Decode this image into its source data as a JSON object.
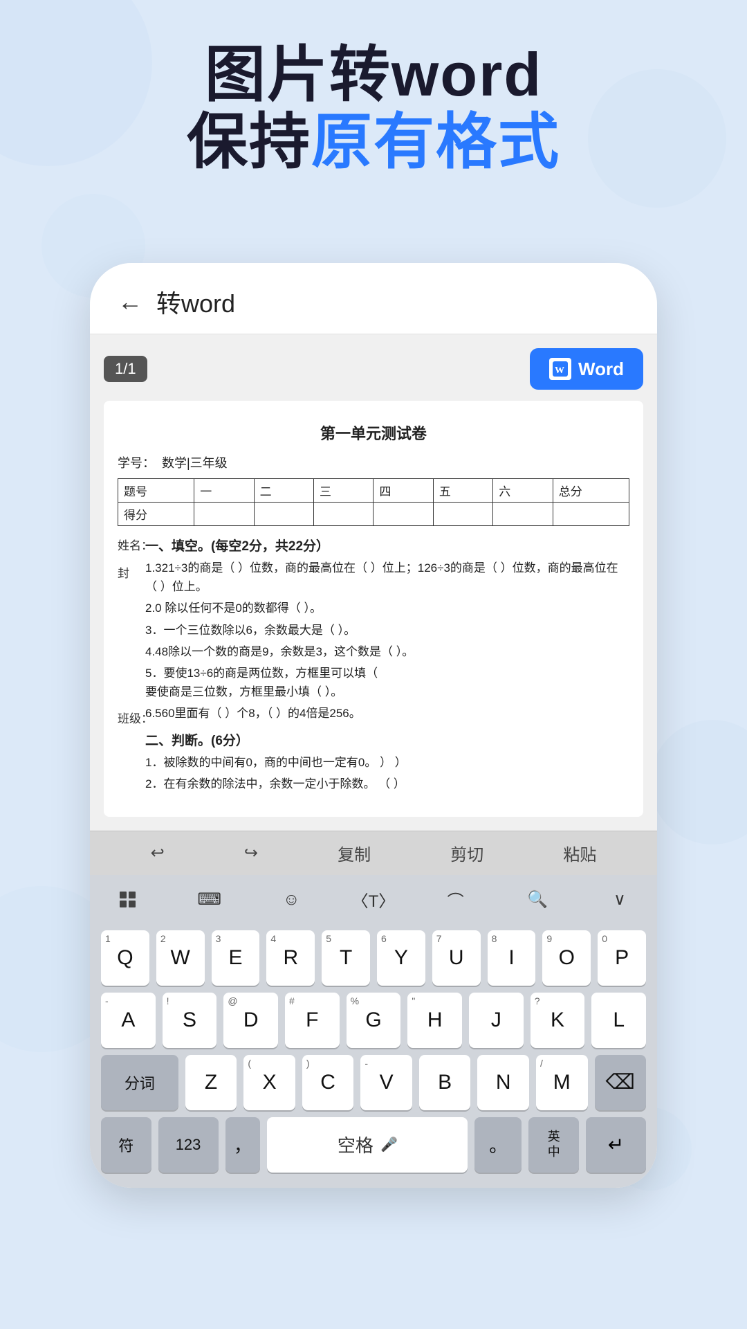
{
  "header": {
    "line1": "图片转word",
    "line2_prefix": "保持",
    "line2_blue": "原有格式",
    "line2_suffix": ""
  },
  "appbar": {
    "back_label": "←",
    "title": "转word"
  },
  "toolbar": {
    "page_badge": "1/1",
    "word_button_label": "Word"
  },
  "document": {
    "title": "第一单元测试卷",
    "field_xue_hao": "学号：",
    "field_ke_mu": "数学|三年级",
    "table_headers": [
      "题号",
      "一",
      "二",
      "三",
      "四",
      "五",
      "六",
      "总分"
    ],
    "table_row1": [
      "得分",
      "",
      "",
      "",
      "",
      "",
      "",
      ""
    ],
    "section1": "一、填空。(每空2分，共22分）",
    "items": [
      "1.321÷3的商是（ ）位数，商的最高位在（ ）位上；126÷3的商是（ ）位数，商的最高位在（ ）位上。",
      "2.0 除以任何不是0的数都得（ ）。",
      "3．一个三位数除以6，余数最大是（ ）。",
      "4.48除以一个数的商是9，余数是3，这个数是（ ）。",
      "5．要使13÷6的商是两位数，方框里可以填（要使商是三位数，方框里最小填（ ）。",
      "6.560里面有（ ）个8，（ ）的4倍是256。"
    ],
    "section2": "二、判断。(6分）",
    "judge_items": [
      "1．被除数的中间有0，商的中间也一定有0。    ）           ）",
      "2．在有余数的除法中，余数一定小于除数。    （  ）"
    ],
    "side_label_xing": "姓名：",
    "side_label_feng": "封",
    "side_label_ban": "班级："
  },
  "keyboard_toolbar": {
    "undo_label": "↩",
    "redo_label": "↪",
    "copy_label": "复制",
    "cut_label": "剪切",
    "paste_label": "粘贴"
  },
  "keyboard_switcher": {
    "icons": [
      "grid",
      "keyboard",
      "emoji",
      "code",
      "link",
      "search",
      "chevron"
    ]
  },
  "keyboard": {
    "row1": [
      "Q",
      "W",
      "E",
      "R",
      "T",
      "Y",
      "U",
      "I",
      "O",
      "P"
    ],
    "row1_top": [
      "1",
      "2",
      "3",
      "4",
      "5",
      "6",
      "7",
      "8",
      "9",
      "0"
    ],
    "row2": [
      "A",
      "S",
      "D",
      "F",
      "G",
      "H",
      "J",
      "K",
      "L"
    ],
    "row2_top": [
      "-",
      "!",
      "@",
      "#",
      "%",
      "\"",
      "",
      "?",
      ""
    ],
    "row3_main": [
      "Z",
      "X",
      "C",
      "V",
      "B",
      "N",
      "M"
    ],
    "row3_top": [
      "",
      "(",
      ")",
      "-",
      "",
      "",
      "/"
    ],
    "special_left": "分词",
    "delete_label": "⌫",
    "bottom_special": "符",
    "bottom_123": "123",
    "bottom_comma": "，",
    "bottom_space": "空格",
    "bottom_period": "。",
    "bottom_lang": "英\n中",
    "bottom_enter": "↵"
  }
}
